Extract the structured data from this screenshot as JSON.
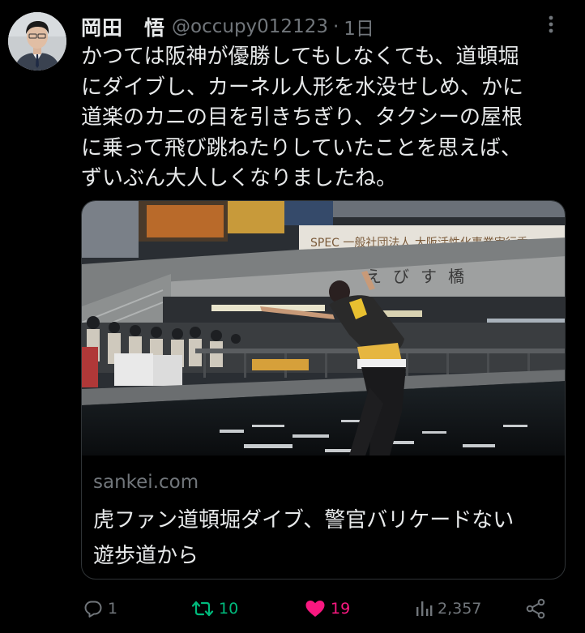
{
  "author": {
    "display_name": "岡田　悟",
    "handle": "@occupy012123",
    "separator": "·",
    "time": "1日"
  },
  "tweet": {
    "lines": [
      "かつては阪神が優勝してもしなくても、道頓堀",
      "にダイブし、カーネル人形を水没せしめ、かに",
      "道楽のカニの目を引きちぎり、タクシーの屋根",
      "に乗って飛び跳ねたりしていたことを思えば、",
      "ずいぶん大人しくなりましたね。"
    ]
  },
  "card": {
    "image_signage": {
      "banner": "SPEC  一般社団法人 大阪活性化事業実行委",
      "bridge_name": "えびす橋"
    },
    "domain": "sankei.com",
    "title_lines": [
      "虎ファン道頓堀ダイブ、警官バリケードない",
      "遊歩道から"
    ]
  },
  "actions": {
    "replies": "1",
    "retweets": "10",
    "likes": "19",
    "views": "2,357"
  },
  "colors": {
    "background": "#000000",
    "text": "#e7e9ea",
    "muted": "#71767b",
    "retweet": "#00ba7c",
    "like": "#f91880",
    "border": "#2f3336"
  },
  "icons": [
    "more-icon",
    "reply-icon",
    "retweet-icon",
    "heart-icon",
    "views-icon",
    "share-icon"
  ]
}
